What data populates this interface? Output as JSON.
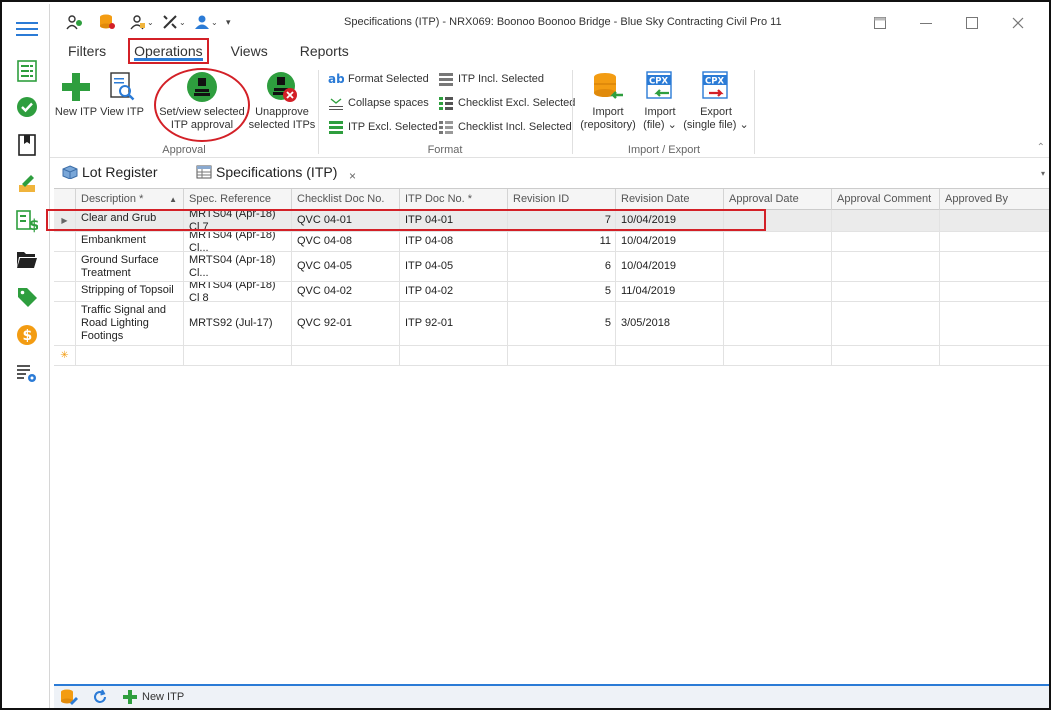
{
  "window": {
    "title": "Specifications (ITP) - NRX069: Boonoo Boonoo Bridge  - Blue Sky Contracting Civil Pro 11"
  },
  "ribbon_tabs": [
    "Filters",
    "Operations",
    "Views",
    "Reports"
  ],
  "active_ribbon_tab": "Operations",
  "ribbon": {
    "new_itp": "New ITP",
    "view_itp": "View ITP",
    "set_view_approval_l1": "Set/view selected",
    "set_view_approval_l2": "ITP approval",
    "unapprove_l1": "Unapprove",
    "unapprove_l2": "selected ITPs",
    "approval_group": "Approval",
    "format_selected": "Format Selected",
    "collapse_spaces": "Collapse spaces",
    "itp_excl_selected": "ITP Excl. Selected",
    "itp_incl_selected": "ITP Incl. Selected",
    "checklist_excl_selected": "Checklist Excl. Selected",
    "checklist_incl_selected": "Checklist Incl. Selected",
    "format_group": "Format",
    "import_repo_l1": "Import",
    "import_repo_l2": "(repository)",
    "import_file_l1": "Import",
    "import_file_l2": "(file) ⌄",
    "export_l1": "Export",
    "export_l2": "(single file) ⌄",
    "import_export_group": "Import / Export",
    "cpx": "CPX"
  },
  "doc_tabs": {
    "lot_register": "Lot Register",
    "specifications": "Specifications (ITP)",
    "close": "×"
  },
  "grid": {
    "columns": [
      "Description *",
      "Spec. Reference",
      "Checklist Doc No.",
      "ITP Doc No. *",
      "Revision ID",
      "Revision Date",
      "Approval Date",
      "Approval Comment",
      "Approved By"
    ],
    "rows": [
      {
        "desc": "Clear and Grub",
        "spec": "MRTS04 (Apr-18) Cl 7",
        "checklist": "QVC 04-01",
        "itp": "ITP 04-01",
        "rev": "7",
        "date": "10/04/2019"
      },
      {
        "desc": "Embankment",
        "spec": "MRTS04 (Apr-18) Cl...",
        "checklist": "QVC 04-08",
        "itp": "ITP 04-08",
        "rev": "11",
        "date": "10/04/2019"
      },
      {
        "desc": "Ground Surface Treatment",
        "spec": "MRTS04 (Apr-18) Cl...",
        "checklist": "QVC 04-05",
        "itp": "ITP 04-05",
        "rev": "6",
        "date": "10/04/2019"
      },
      {
        "desc": "Stripping of Topsoil",
        "spec": "MRTS04 (Apr-18) Cl 8",
        "checklist": "QVC 04-02",
        "itp": "ITP 04-02",
        "rev": "5",
        "date": "11/04/2019"
      },
      {
        "desc": "Traffic Signal and Road Lighting Footings",
        "spec": "MRTS92 (Jul-17)",
        "checklist": "QVC 92-01",
        "itp": "ITP 92-01",
        "rev": "5",
        "date": "3/05/2018"
      }
    ],
    "new_row_marker": "✳"
  },
  "bottombar": {
    "new_itp": "New ITP"
  },
  "colors": {
    "highlight": "#d32027",
    "accent": "#2b7bd6",
    "green": "#2e9e3e"
  }
}
